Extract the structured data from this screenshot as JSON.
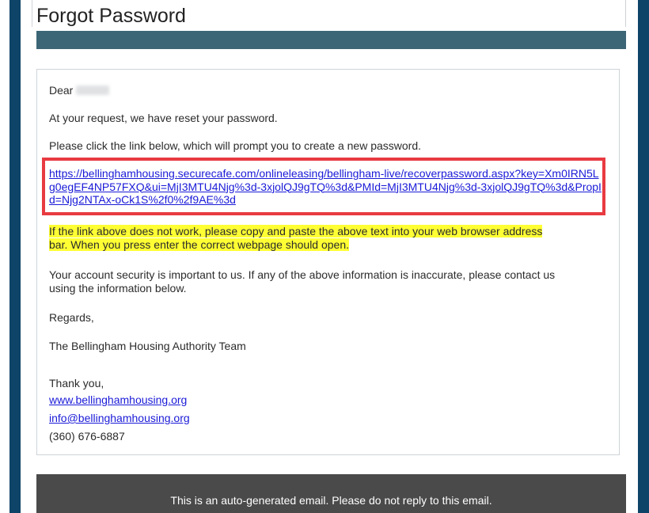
{
  "header": {
    "title": "Forgot Password"
  },
  "email": {
    "greeting": "Dear",
    "reset_notice": "At your request, we have reset your password.",
    "instruction": "Please click the link below, which will prompt you to create a new password.",
    "reset_link": "https://bellinghamhousing.securecafe.com/onlineleasing/bellingham-live/recoverpassword.aspx?key=Xm0IRN5Lg0egEF4NP57FXQ&ui=MjI3MTU4Njg%3d-3xjolQJ9gTQ%3d&PMId=MjI3MTU4Njg%3d-3xjolQJ9gTQ%3d&PropId=Njg2NTAx-oCk1S%2f0%2f9AE%3d",
    "copy_paste_line1": "If the link above does not work, please copy and paste the above text into your web browser address",
    "copy_paste_line2": "bar.  When you press enter the correct webpage should open.",
    "security_line1": "Your account security is important to us. If any of the above information is inaccurate, please contact us",
    "security_line2": "using the information below.",
    "regards": "Regards,",
    "signature": "The Bellingham Housing Authority Team",
    "thank_you": "Thank you,",
    "website_link": "www.bellinghamhousing.org",
    "email_link": "info@bellinghamhousing.org",
    "phone": "(360) 676-6887"
  },
  "footer": {
    "notice": "This is an auto-generated email. Please do not reply to this email."
  },
  "colors": {
    "side_bar": "#0d4467",
    "teal_band": "#3c6675",
    "link": "#1a1ad8",
    "highlight": "#ffff33",
    "callout_border": "#e83a41",
    "footer_bg": "#4a4a4a"
  }
}
